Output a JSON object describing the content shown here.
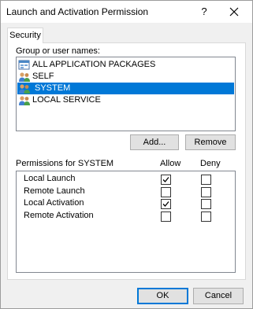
{
  "window": {
    "title": "Launch and Activation Permission",
    "help_glyph": "?"
  },
  "tabs": [
    {
      "label": "Security",
      "selected": true
    }
  ],
  "groups": {
    "label": "Group or user names:",
    "items": [
      {
        "name": "ALL APPLICATION PACKAGES",
        "icon": "app-packages-icon",
        "selected": false
      },
      {
        "name": "SELF",
        "icon": "users-group-icon",
        "selected": false
      },
      {
        "name": "SYSTEM",
        "icon": "users-group-icon",
        "selected": true
      },
      {
        "name": "LOCAL SERVICE",
        "icon": "users-group-icon",
        "selected": false
      }
    ],
    "add_label": "Add...",
    "remove_label": "Remove"
  },
  "permissions": {
    "label": "Permissions for SYSTEM",
    "allow_header": "Allow",
    "deny_header": "Deny",
    "rows": [
      {
        "name": "Local Launch",
        "allow": true,
        "deny": false
      },
      {
        "name": "Remote Launch",
        "allow": false,
        "deny": false
      },
      {
        "name": "Local Activation",
        "allow": true,
        "deny": false
      },
      {
        "name": "Remote Activation",
        "allow": false,
        "deny": false
      }
    ]
  },
  "footer": {
    "ok_label": "OK",
    "cancel_label": "Cancel"
  },
  "colors": {
    "selection": "#0078d7",
    "button_face": "#e1e1e1",
    "dialog_bg": "#f0f0f0"
  }
}
